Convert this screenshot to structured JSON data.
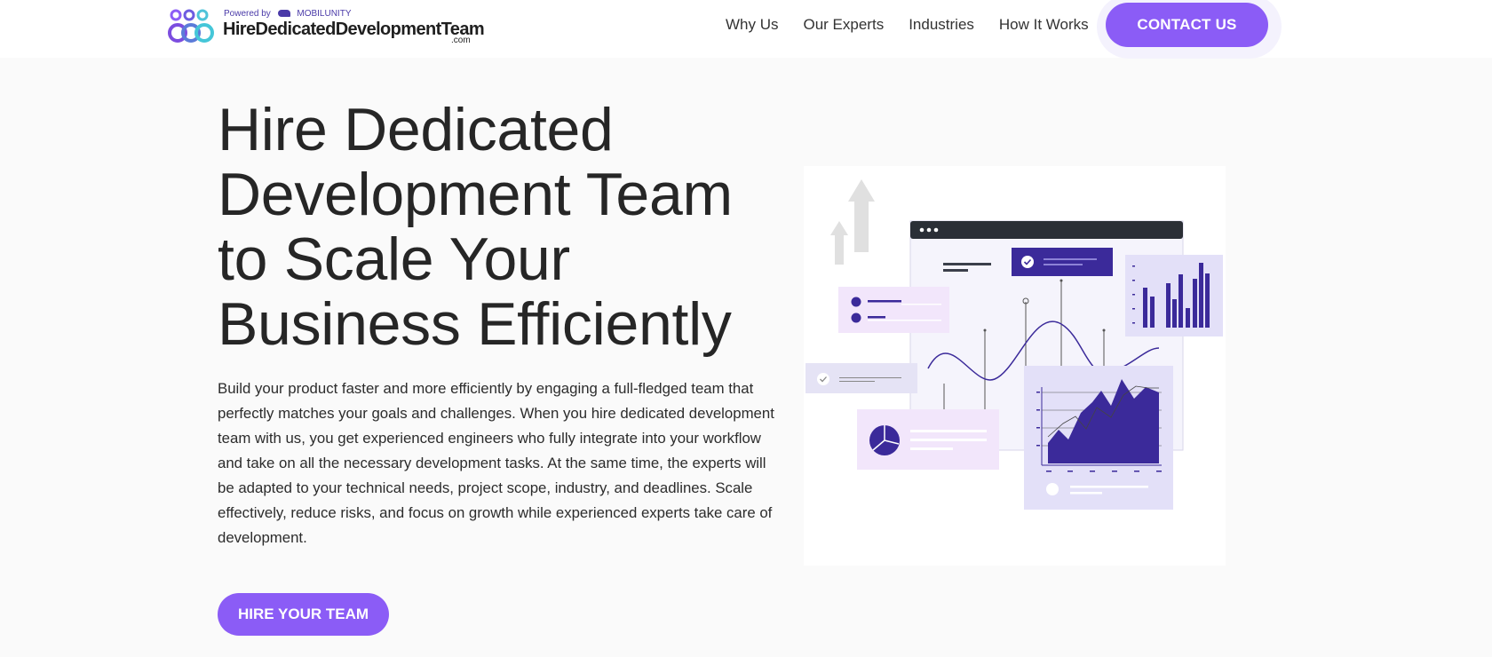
{
  "header": {
    "logo": {
      "powered_by": "Powered by",
      "partner": "MOBILUNITY",
      "name": "HireDedicatedDevelopmentTeam",
      "suffix": ".com"
    },
    "nav": [
      {
        "label": "Why Us"
      },
      {
        "label": "Our Experts"
      },
      {
        "label": "Industries"
      },
      {
        "label": "How It Works"
      }
    ],
    "contact_label": "CONTACT US"
  },
  "hero": {
    "title_lines": [
      "Hire Dedicated",
      "Development Team",
      "to Scale Your",
      "Business Efficiently"
    ],
    "description": "Build your product faster and more efficiently by engaging a full-fledged team that perfectly matches your goals and challenges. When you hire dedicated development team with us, you get experienced engineers who fully integrate into your workflow and take on all the necessary development tasks. At the same time, the experts will be adapted to your technical needs, project scope, industry, and deadlines. Scale effectively, reduce risks, and focus on growth while experienced experts take care of development.",
    "cta_label": "HIRE YOUR TEAM"
  },
  "colors": {
    "accent": "#8b5cf6",
    "dark_purple": "#3b2a9a",
    "text": "#262626",
    "header_bg": "#ffffff",
    "page_bg": "#fafafa"
  }
}
